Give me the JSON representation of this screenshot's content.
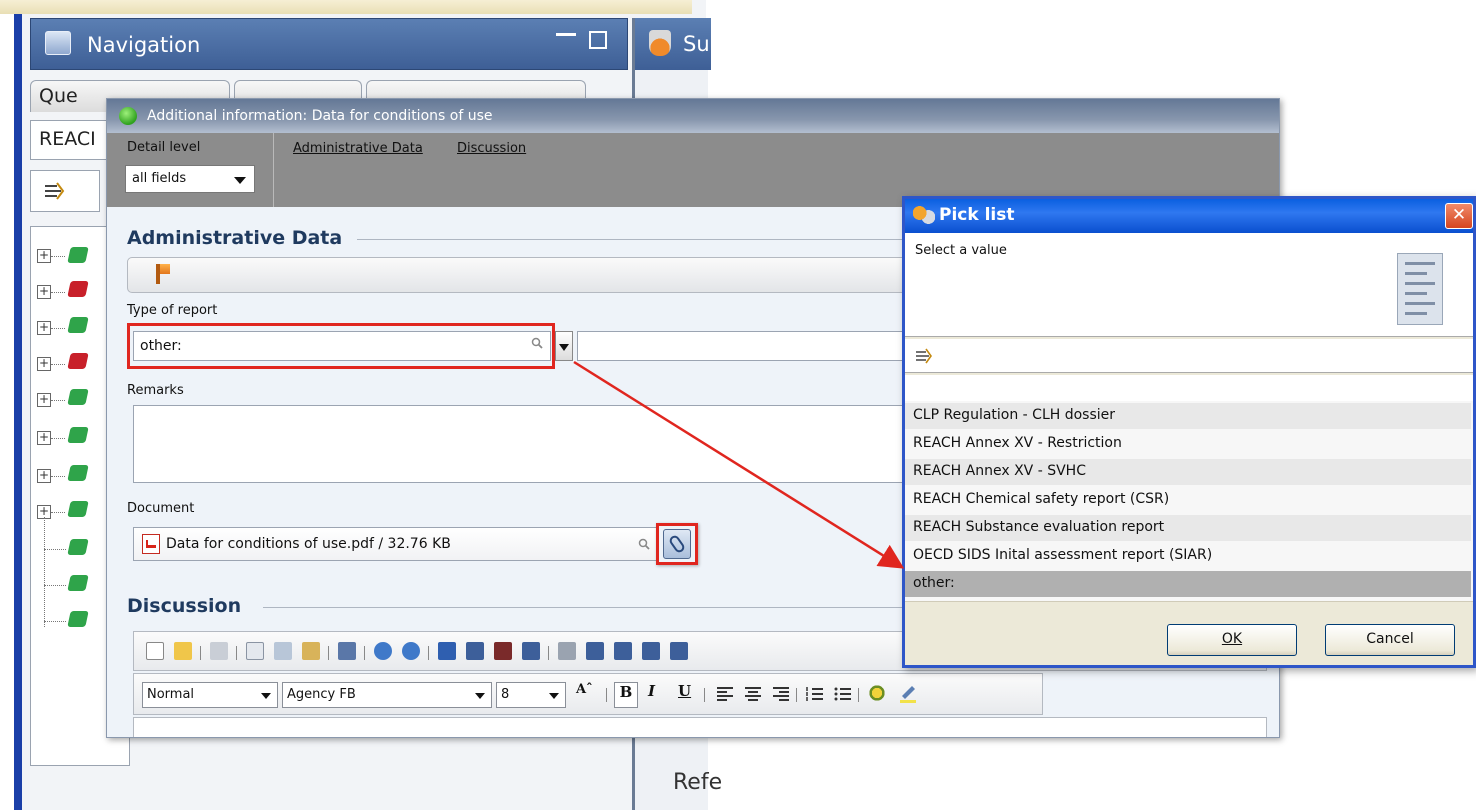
{
  "nav": {
    "title": "Navigation",
    "tabs": [
      "Que",
      "",
      ""
    ],
    "search_value": "REACI",
    "right_title": "Su",
    "right_text_ref": "Refe"
  },
  "dialog": {
    "title": "Additional information: Data for conditions of use",
    "detail_level_label": "Detail level",
    "detail_level_value": "all fields",
    "links": [
      "Administrative Data",
      "Discussion"
    ],
    "admin_section": "Administrative Data",
    "type_of_report_label": "Type of report",
    "type_of_report_value": "other:",
    "remarks_label": "Remarks",
    "document_label": "Document",
    "document_value": "Data for conditions of use.pdf / 32.76 KB",
    "discussion_section": "Discussion",
    "editor": {
      "style_value": "Normal",
      "font_value": "Agency FB",
      "size_value": "8",
      "bold": "B",
      "italic": "I",
      "underline": "U"
    }
  },
  "picklist": {
    "title": "Pick list",
    "prompt": "Select a value",
    "items": [
      "CLP Regulation - CLH dossier",
      "REACH Annex XV - Restriction",
      "REACH Annex XV - SVHC",
      "REACH Chemical safety report (CSR)",
      "REACH Substance evaluation report",
      "OECD SIDS Inital assessment report (SIAR)",
      "other:"
    ],
    "selected": "other:",
    "ok_label": "OK",
    "cancel_label": "Cancel"
  },
  "colors": {
    "highlight": "#e0261f",
    "xp_titlebar": "#0a5fe0",
    "nav_titlebar": "#4a6ea4"
  }
}
